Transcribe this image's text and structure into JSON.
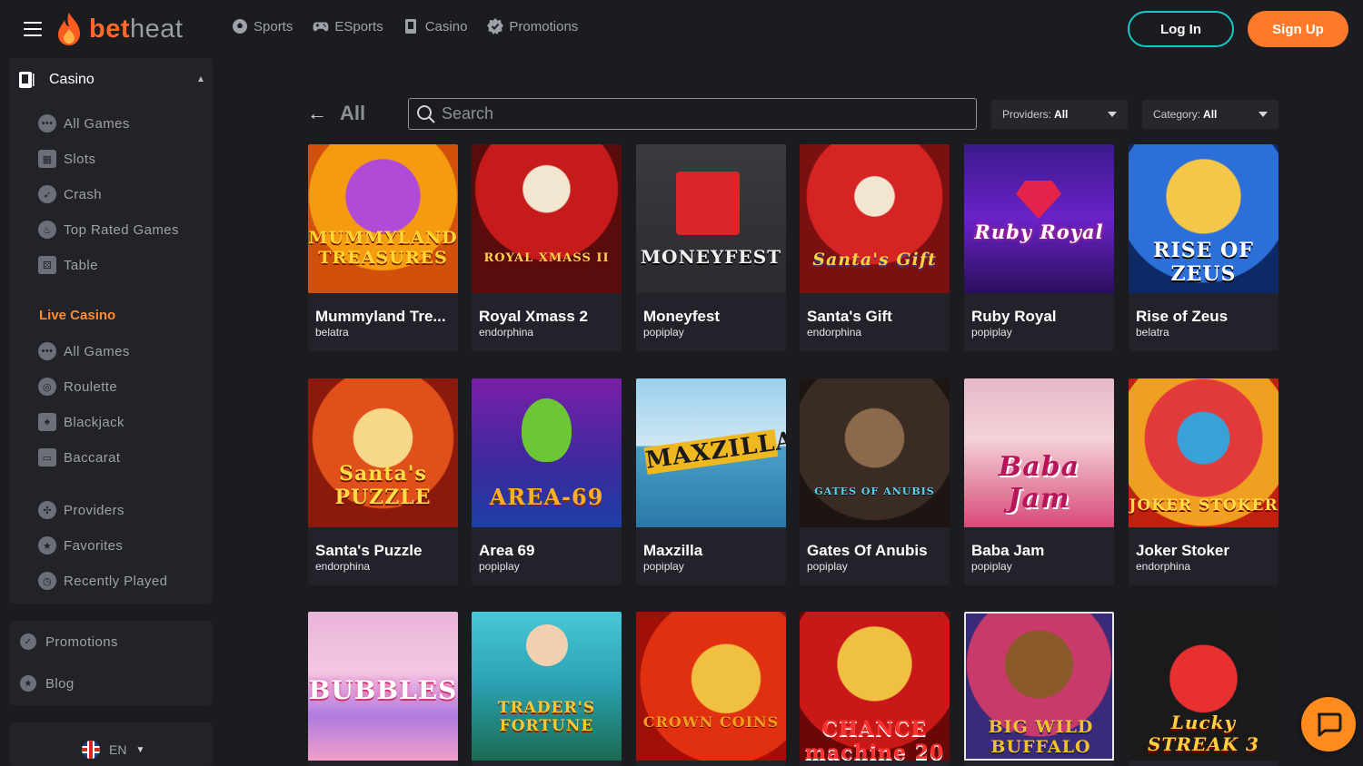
{
  "header": {
    "logo_part1": "bet",
    "logo_part2": "heat",
    "nav": [
      {
        "label": "Sports",
        "icon": "soccer-ball-icon"
      },
      {
        "label": "ESports",
        "icon": "gamepad-icon"
      },
      {
        "label": "Casino",
        "icon": "cards-icon"
      },
      {
        "label": "Promotions",
        "icon": "badge-check-icon"
      }
    ],
    "login_label": "Log In",
    "signup_label": "Sign Up"
  },
  "sidebar": {
    "casino_label": "Casino",
    "casino_items": [
      {
        "label": "All Games",
        "icon": "dots-icon"
      },
      {
        "label": "Slots",
        "icon": "slot-machine-icon"
      },
      {
        "label": "Crash",
        "icon": "rocket-icon"
      },
      {
        "label": "Top Rated Games",
        "icon": "flame-icon"
      },
      {
        "label": "Table",
        "icon": "dice-icon"
      }
    ],
    "live_casino_label": "Live Casino",
    "live_items": [
      {
        "label": "All Games",
        "icon": "dots-icon"
      },
      {
        "label": "Roulette",
        "icon": "roulette-icon"
      },
      {
        "label": "Blackjack",
        "icon": "cards-icon"
      },
      {
        "label": "Baccarat",
        "icon": "chip-icon"
      }
    ],
    "extra_items": [
      {
        "label": "Providers",
        "icon": "grid-icon"
      },
      {
        "label": "Favorites",
        "icon": "star-icon"
      },
      {
        "label": "Recently Played",
        "icon": "clock-icon"
      }
    ],
    "bottom_items": [
      {
        "label": "Promotions",
        "icon": "badge-check-icon"
      },
      {
        "label": "Blog",
        "icon": "star-badge-icon"
      }
    ],
    "language": "EN"
  },
  "toolbar": {
    "back_title": "All",
    "search_placeholder": "Search",
    "providers_label": "Providers:",
    "providers_value": "All",
    "category_label": "Category:",
    "category_value": "All"
  },
  "games": [
    {
      "title": "Mummyland Tre...",
      "provider": "belatra",
      "art_text": "MUMMYLAND TREASURES"
    },
    {
      "title": "Royal Xmass 2",
      "provider": "endorphina",
      "art_text": "ROYAL XMASS II"
    },
    {
      "title": "Moneyfest",
      "provider": "popiplay",
      "art_text": "MONEYFEST"
    },
    {
      "title": "Santa's Gift",
      "provider": "endorphina",
      "art_text": "Santa's Gift"
    },
    {
      "title": "Ruby Royal",
      "provider": "popiplay",
      "art_text": "Ruby Royal"
    },
    {
      "title": "Rise of Zeus",
      "provider": "belatra",
      "art_text": "RISE OF ZEUS"
    },
    {
      "title": "Santa's Puzzle",
      "provider": "endorphina",
      "art_text": "Santa's PUZZLE"
    },
    {
      "title": "Area 69",
      "provider": "popiplay",
      "art_text": "AREA-69"
    },
    {
      "title": "Maxzilla",
      "provider": "popiplay",
      "art_text": "MAXZILLA"
    },
    {
      "title": "Gates Of Anubis",
      "provider": "popiplay",
      "art_text": "GATES OF ANUBIS"
    },
    {
      "title": "Baba Jam",
      "provider": "popiplay",
      "art_text": "Baba Jam"
    },
    {
      "title": "Joker Stoker",
      "provider": "endorphina",
      "art_text": "JOKER STOKER"
    },
    {
      "title": "",
      "provider": "",
      "art_text": "BUBBLES"
    },
    {
      "title": "",
      "provider": "",
      "art_text": "TRADER'S FORTUNE"
    },
    {
      "title": "",
      "provider": "",
      "art_text": "CROWN COINS"
    },
    {
      "title": "",
      "provider": "",
      "art_text": "CHANCE machine 20"
    },
    {
      "title": "",
      "provider": "",
      "art_text": "BIG WILD BUFFALO"
    },
    {
      "title": "",
      "provider": "",
      "art_text": "Lucky STREAK 3"
    }
  ],
  "colors": {
    "accent_orange": "#ff7a2a",
    "login_border": "#16c8c8",
    "live_casino": "#ff8b2a",
    "background": "#1b1c20"
  }
}
